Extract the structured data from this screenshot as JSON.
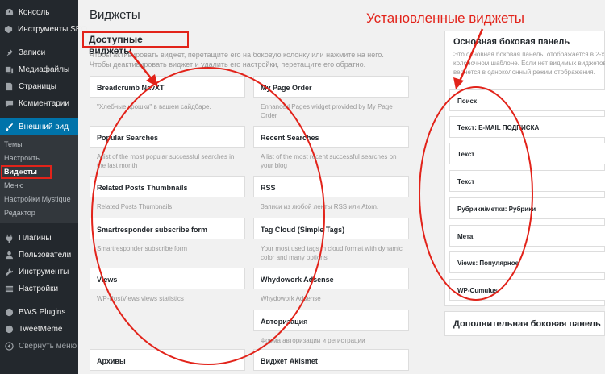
{
  "sidebar": {
    "items": [
      {
        "label": "Консоль",
        "icon": "dashboard-icon"
      },
      {
        "label": "Инструменты SEO",
        "icon": "seo-icon"
      },
      {
        "label": "Записи",
        "icon": "pin-icon"
      },
      {
        "label": "Медиафайлы",
        "icon": "media-icon"
      },
      {
        "label": "Страницы",
        "icon": "page-icon"
      },
      {
        "label": "Комментарии",
        "icon": "comment-icon"
      },
      {
        "label": "Внешний вид",
        "icon": "brush-icon"
      },
      {
        "label": "Плагины",
        "icon": "plugin-icon"
      },
      {
        "label": "Пользователи",
        "icon": "users-icon"
      },
      {
        "label": "Инструменты",
        "icon": "wrench-icon"
      },
      {
        "label": "Настройки",
        "icon": "settings-icon"
      },
      {
        "label": "BWS Plugins",
        "icon": "bws-icon"
      },
      {
        "label": "TweetMeme",
        "icon": "tweetmeme-icon"
      },
      {
        "label": "Свернуть меню",
        "icon": "collapse-icon"
      }
    ],
    "submenu": [
      "Темы",
      "Настроить",
      "Виджеты",
      "Меню",
      "Настройки Mystique",
      "Редактор"
    ]
  },
  "main": {
    "title": "Виджеты",
    "available_heading": "Доступные виджеты",
    "available_desc": "Чтобы активировать виджет, перетащите его на боковую колонку или нажмите на него. Чтобы деактивировать виджет и удалить его настройки, перетащите его обратно.",
    "widgets": [
      {
        "name": "Breadcrumb NavXT",
        "desc": "\"Хлебные крошки\" в вашем сайдбаре."
      },
      {
        "name": "My Page Order",
        "desc": "Enhanced Pages widget provided by My Page Order"
      },
      {
        "name": "Popular Searches",
        "desc": "A list of the most popular successful searches in the last month"
      },
      {
        "name": "Recent Searches",
        "desc": "A list of the most recent successful searches on your blog"
      },
      {
        "name": "Related Posts Thumbnails",
        "desc": "Related Posts Thumbnails"
      },
      {
        "name": "RSS",
        "desc": "Записи из любой ленты RSS или Atom."
      },
      {
        "name": "Smartresponder subscribe form",
        "desc": "Smartresponder subscribe form"
      },
      {
        "name": "Tag Cloud (Simple Tags)",
        "desc": "Your most used tags in cloud format with dynamic color and many options"
      },
      {
        "name": "Views",
        "desc": "WP-PostViews views statistics"
      },
      {
        "name": "Whydowork Adsense",
        "desc": "Whydowork Adsense"
      },
      {
        "name": "Авторизация",
        "desc": "Форма авторизации и регистрации"
      },
      {
        "name": "Архивы",
        "desc": ""
      },
      {
        "name": "Виджет Akismet",
        "desc": ""
      }
    ],
    "installed_label": "Установленные виджеты",
    "primary_panel": {
      "title": "Основная боковая панель",
      "desc": [
        "Это основная боковая панель, отображается в 2-х",
        "колоночном шаблоне. Если нет видимых виджетов,",
        "вернется в одноколонный режим отображения."
      ],
      "widgets": [
        "Поиск",
        "Текст: E-MAIL ПОДПИСКА",
        "Текст",
        "Текст",
        "Рубрики/метки: Рубрики",
        "Мета",
        "Views: Популярное",
        "WP-Cumulus"
      ]
    },
    "secondary_panel": {
      "title": "Дополнительная боковая панель"
    }
  },
  "colors": {
    "admin_bar": "#23282d",
    "active": "#0073aa",
    "annotation": "#e2231a"
  }
}
